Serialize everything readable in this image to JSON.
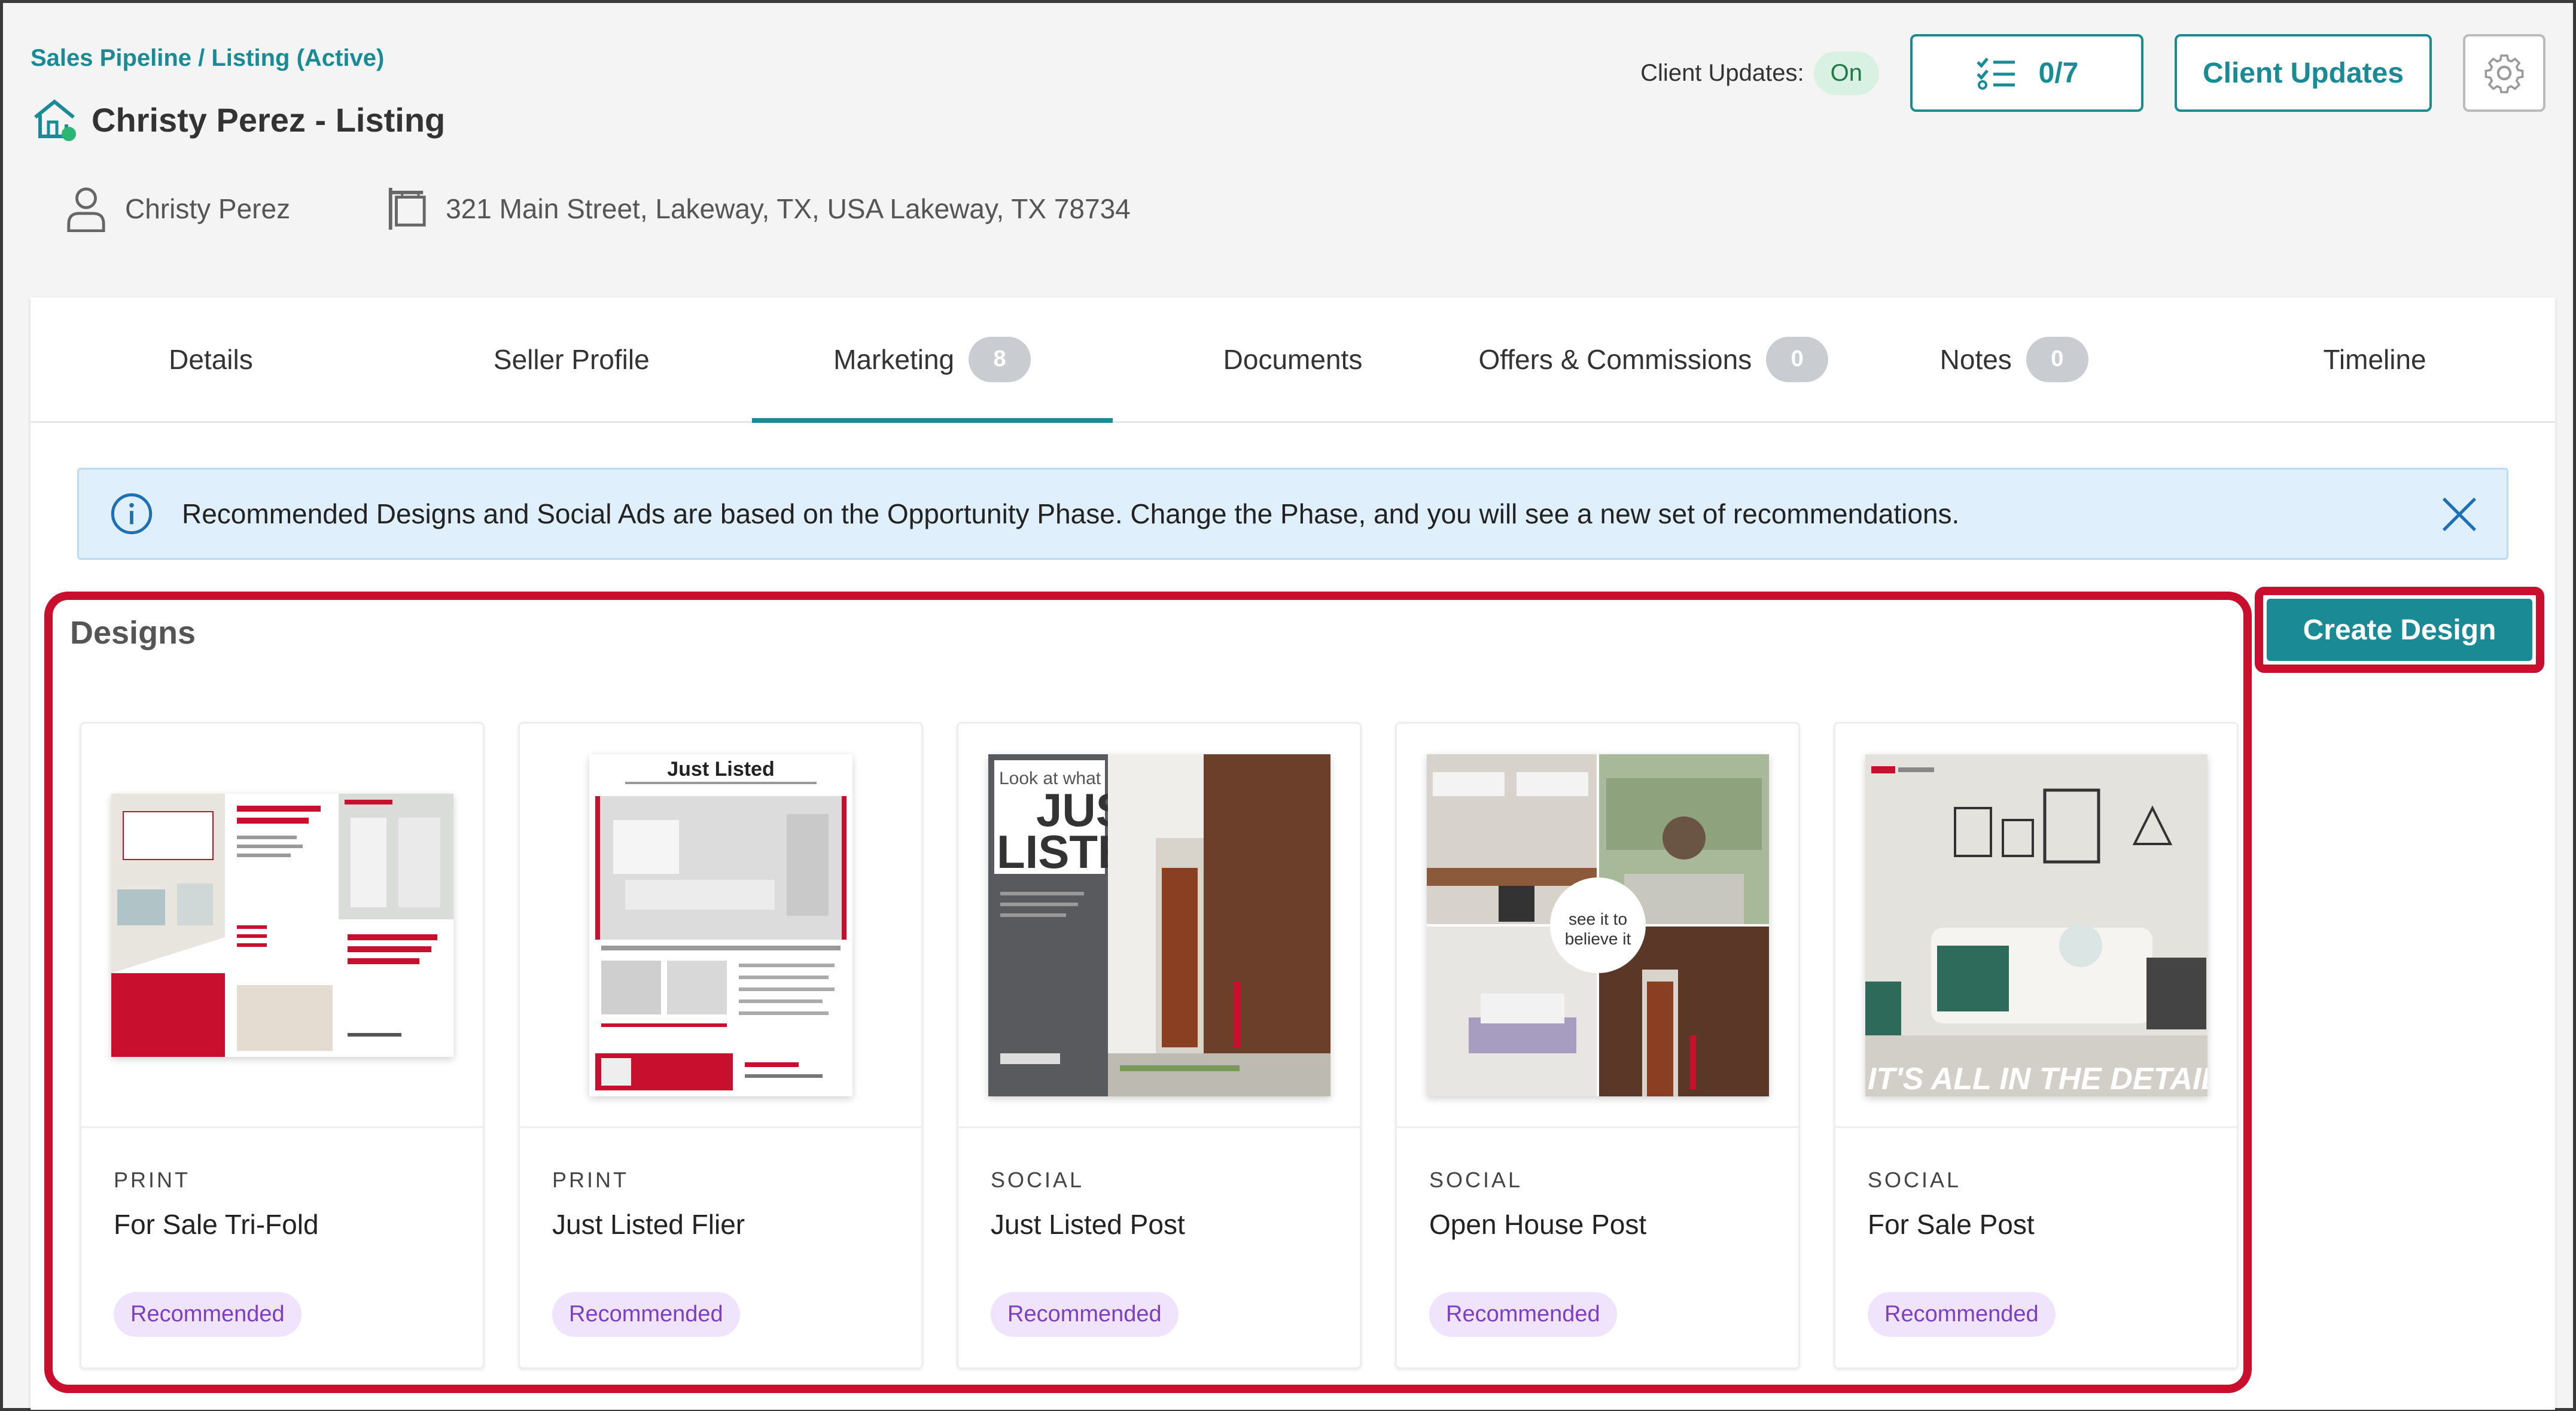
{
  "header": {
    "breadcrumb": "Sales Pipeline / Listing (Active)",
    "title": "Christy Perez - Listing",
    "contact_name": "Christy Perez",
    "address": "321 Main Street, Lakeway, TX, USA Lakeway, TX 78734",
    "client_updates_label": "Client Updates:",
    "client_updates_status": "On",
    "checklist_count": "0/7",
    "client_updates_button": "Client Updates"
  },
  "tabs": [
    {
      "label": "Details",
      "badge": ""
    },
    {
      "label": "Seller Profile",
      "badge": ""
    },
    {
      "label": "Marketing",
      "badge": "8"
    },
    {
      "label": "Documents",
      "badge": ""
    },
    {
      "label": "Offers & Commissions",
      "badge": "0"
    },
    {
      "label": "Notes",
      "badge": "0"
    },
    {
      "label": "Timeline",
      "badge": ""
    }
  ],
  "active_tab": "Marketing",
  "banner": {
    "text": "Recommended Designs and Social Ads are based on the Opportunity Phase. Change the Phase, and you will see a new set of recommendations."
  },
  "designs": {
    "title": "Designs",
    "create_button": "Create Design",
    "items": [
      {
        "type": "PRINT",
        "name": "For Sale Tri-Fold",
        "badge": "Recommended"
      },
      {
        "type": "PRINT",
        "name": "Just Listed Flier",
        "badge": "Recommended"
      },
      {
        "type": "SOCIAL",
        "name": "Just Listed Post",
        "badge": "Recommended"
      },
      {
        "type": "SOCIAL",
        "name": "Open House Post",
        "badge": "Recommended"
      },
      {
        "type": "SOCIAL",
        "name": "For Sale Post",
        "badge": "Recommended"
      }
    ]
  },
  "thumbnails": {
    "flier_heading": "Just Listed",
    "post_line1": "Look at what",
    "post_big1": "JUST",
    "post_big2": "LISTED",
    "openhouse_line1": "see it to",
    "openhouse_line2": "believe it",
    "forsale_caption": "IT'S ALL IN THE DETAILS"
  },
  "colors": {
    "accent": "#1a8a94",
    "highlight": "#c8102e",
    "badge_bg": "#efe4fb",
    "badge_text": "#7d3fbf"
  }
}
